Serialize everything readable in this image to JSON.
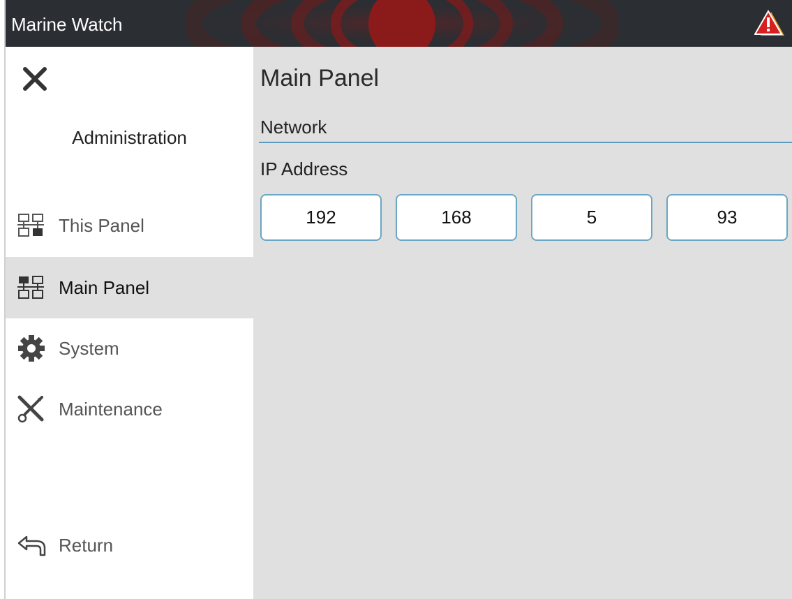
{
  "titlebar": {
    "title": "Marine Watch",
    "alarm_icon": "warning-triangle-icon",
    "colors": {
      "background": "#2b2e33",
      "alarm": "#d42020",
      "pulse": "#8b1a1a"
    }
  },
  "sidebar": {
    "close_icon": "close-icon",
    "heading": "Administration",
    "items": [
      {
        "label": "This Panel",
        "icon": "network-icon",
        "active": false
      },
      {
        "label": "Main Panel",
        "icon": "network-icon",
        "active": true
      },
      {
        "label": "System",
        "icon": "gear-icon",
        "active": false
      },
      {
        "label": "Maintenance",
        "icon": "tools-icon",
        "active": false
      }
    ],
    "return_label": "Return",
    "return_icon": "return-arrow-icon"
  },
  "main": {
    "title": "Main Panel",
    "section": "Network",
    "field_label": "IP Address",
    "ip_octets": [
      "192",
      "168",
      "5",
      "93"
    ],
    "colors": {
      "rule": "#5a9bbf",
      "input_border": "#6aa7c4",
      "panel_bg": "#e0e0e0"
    }
  }
}
